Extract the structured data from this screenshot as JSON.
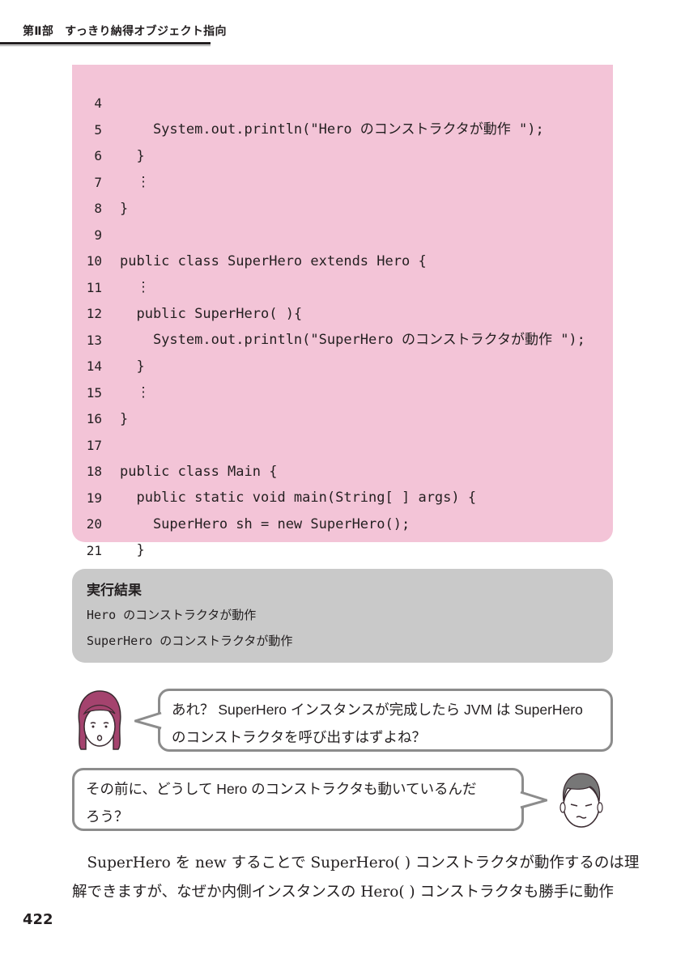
{
  "header": {
    "part": "第Ⅱ部",
    "title": "すっきり納得オブジェクト指向"
  },
  "code": {
    "lines": [
      {
        "num": "4",
        "text": "    System.out.println(\"Hero のコンストラクタが動作 \");"
      },
      {
        "num": "5",
        "text": "  }"
      },
      {
        "num": "6",
        "text": "  ⋮"
      },
      {
        "num": "7",
        "text": "}"
      },
      {
        "num": "8",
        "text": ""
      },
      {
        "num": "9",
        "text": "public class SuperHero extends Hero {"
      },
      {
        "num": "10",
        "text": "  ⋮"
      },
      {
        "num": "11",
        "text": "  public SuperHero( ){"
      },
      {
        "num": "12",
        "text": "    System.out.println(\"SuperHero のコンストラクタが動作 \");"
      },
      {
        "num": "13",
        "text": "  }"
      },
      {
        "num": "14",
        "text": "  ⋮"
      },
      {
        "num": "15",
        "text": "}"
      },
      {
        "num": "16",
        "text": ""
      },
      {
        "num": "17",
        "text": "public class Main {"
      },
      {
        "num": "18",
        "text": "  public static void main(String[ ] args) {"
      },
      {
        "num": "19",
        "text": "    SuperHero sh = new SuperHero();"
      },
      {
        "num": "20",
        "text": "  }"
      },
      {
        "num": "21",
        "text": "}"
      }
    ]
  },
  "result": {
    "title": "実行結果",
    "lines": [
      "Hero のコンストラクタが動作",
      "SuperHero のコンストラクタが動作"
    ]
  },
  "dialog": {
    "woman_line1": "あれ？ SuperHero インスタンスが完成したら JVM は SuperHero",
    "woman_line2": "のコンストラクタを呼び出すはずよね？",
    "man_line1": "その前に、どうして Hero のコンストラクタも動いているんだ",
    "man_line2": "ろう？"
  },
  "body": {
    "line1": "　SuperHero を new することで SuperHero( ) コンストラクタが動作するのは理",
    "line2": "解できますが、なぜか内側インスタンスの Hero( ) コンストラクタも勝手に動作"
  },
  "page_number": "422",
  "colors": {
    "code_bg": "#f3c4d7",
    "result_bg": "#c9c9c9",
    "bubble_border": "#8c8c8c",
    "woman_hair": "#a4436e",
    "man_hair": "#777777"
  }
}
